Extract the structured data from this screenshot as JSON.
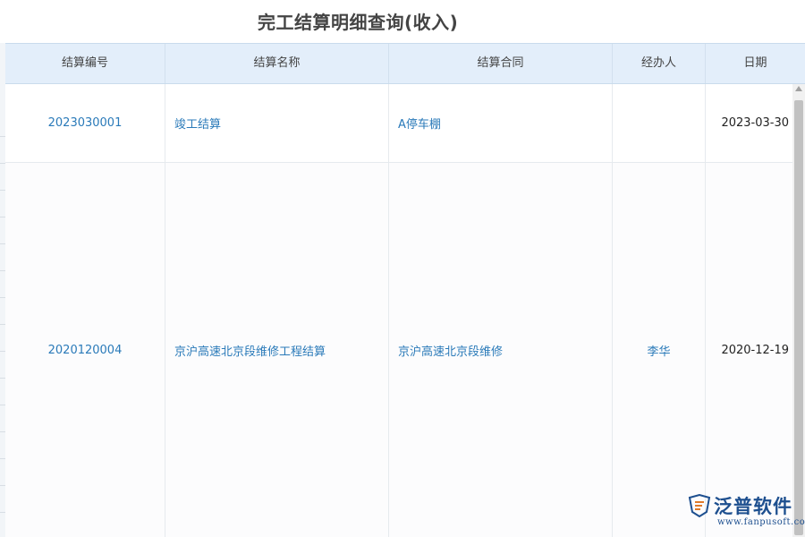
{
  "page": {
    "title": "完工结算明细查询(收入)"
  },
  "table": {
    "columns": [
      "结算编号",
      "结算名称",
      "结算合同",
      "经办人",
      "日期"
    ],
    "rows": [
      {
        "code": "2023030001",
        "name": "竣工结算",
        "contract": "A停车棚",
        "handler": "",
        "date": "2023-03-30"
      },
      {
        "code": "2020120004",
        "name": "京沪高速北京段维修工程结算",
        "contract": "京沪高速北京段维修",
        "handler": "李华",
        "date": "2020-12-19"
      }
    ]
  },
  "watermark": {
    "brand": "泛普软件",
    "url": "www.fanpusoft.com"
  },
  "colors": {
    "header_bg": "#e3eefa",
    "link": "#2a7ab9",
    "brand": "#1d4f8f"
  }
}
